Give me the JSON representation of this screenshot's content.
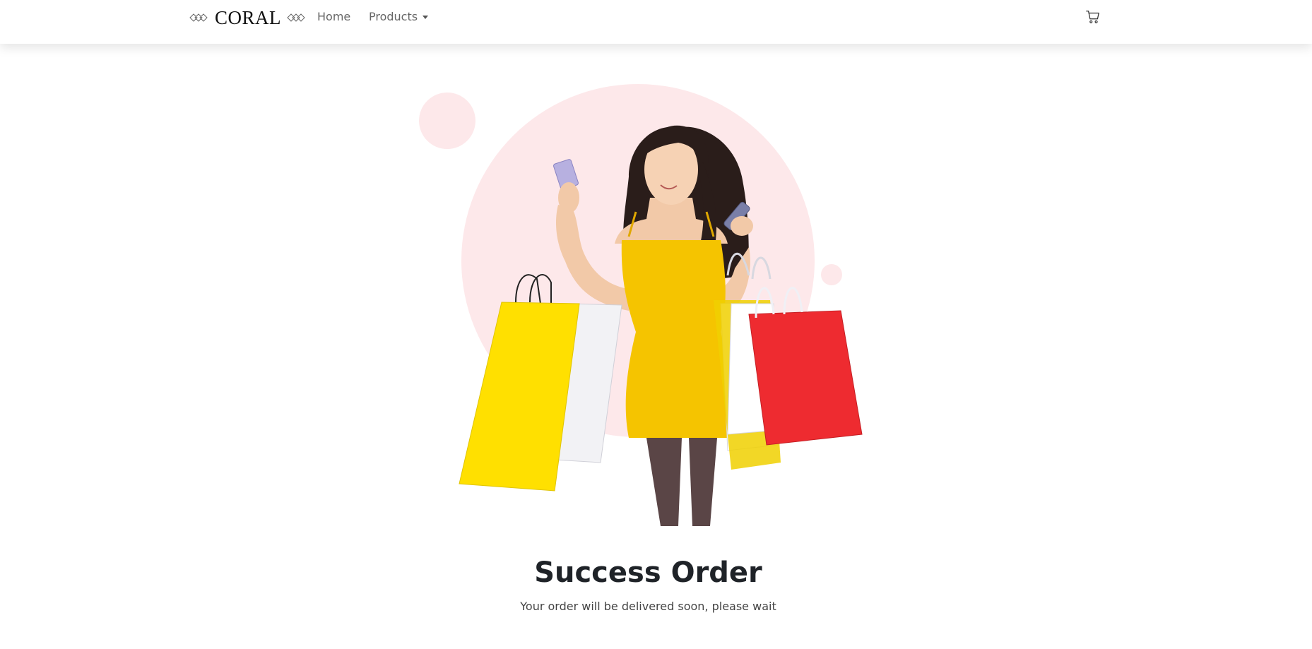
{
  "brand": {
    "name": "CORAL",
    "left_icon": "diamonds-icon",
    "right_icon": "diamonds-icon"
  },
  "nav": {
    "home_label": "Home",
    "products_label": "Products",
    "products_icon": "caret-down-icon",
    "cart_icon": "cart-icon"
  },
  "hero": {
    "image": "shopping-woman-illustration",
    "accent_color": "#fde8ea"
  },
  "message": {
    "title": "Success Order",
    "subtitle": "Your order will be delivered soon, please wait"
  }
}
